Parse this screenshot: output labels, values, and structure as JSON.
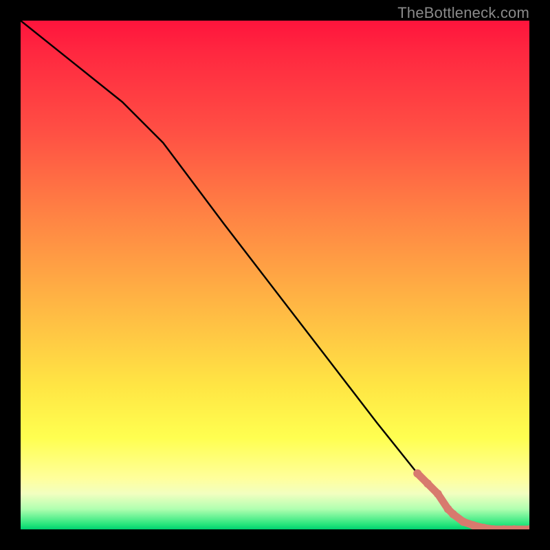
{
  "watermark": "TheBottleneck.com",
  "chart_data": {
    "type": "line",
    "title": "",
    "xlabel": "",
    "ylabel": "",
    "xlim": [
      0,
      100
    ],
    "ylim": [
      0,
      100
    ],
    "grid": false,
    "series": [
      {
        "name": "curve",
        "x": [
          0,
          10,
          20,
          28,
          40,
          50,
          60,
          70,
          78,
          84,
          88,
          92,
          96,
          100
        ],
        "y": [
          100,
          92,
          84,
          76,
          60,
          47,
          34,
          21,
          11,
          4,
          1,
          0,
          0,
          0
        ]
      }
    ],
    "markers": {
      "name": "data-points",
      "color": "#d87a6e",
      "x": [
        78,
        80,
        82,
        84,
        85,
        87,
        89,
        91,
        93,
        95,
        97,
        100
      ],
      "y": [
        11,
        9,
        7,
        4,
        3,
        1.5,
        0.8,
        0.3,
        0,
        0,
        0,
        0
      ]
    }
  }
}
